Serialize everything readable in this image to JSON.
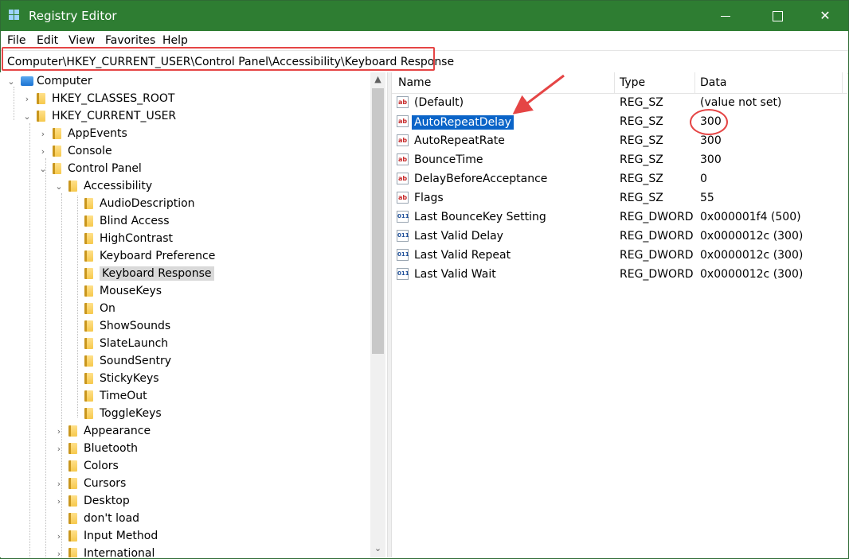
{
  "window": {
    "title": "Registry Editor"
  },
  "menu": [
    "File",
    "Edit",
    "View",
    "Favorites",
    "Help"
  ],
  "address": "Computer\\HKEY_CURRENT_USER\\Control Panel\\Accessibility\\Keyboard Response",
  "tree": [
    "Computer",
    "HKEY_CLASSES_ROOT",
    "HKEY_CURRENT_USER",
    "AppEvents",
    "Console",
    "Control Panel",
    "Accessibility",
    "AudioDescription",
    "Blind Access",
    "HighContrast",
    "Keyboard Preference",
    "Keyboard Response",
    "MouseKeys",
    "On",
    "ShowSounds",
    "SlateLaunch",
    "SoundSentry",
    "StickyKeys",
    "TimeOut",
    "ToggleKeys",
    "Appearance",
    "Bluetooth",
    "Colors",
    "Cursors",
    "Desktop",
    "don't load",
    "Input Method",
    "International"
  ],
  "columns": {
    "name": "Name",
    "type": "Type",
    "data": "Data"
  },
  "values": [
    {
      "icon": "string-value-icon",
      "name": "(Default)",
      "type": "REG_SZ",
      "data": "(value not set)"
    },
    {
      "icon": "string-value-icon",
      "name": "AutoRepeatDelay",
      "type": "REG_SZ",
      "data": "300"
    },
    {
      "icon": "string-value-icon",
      "name": "AutoRepeatRate",
      "type": "REG_SZ",
      "data": "300"
    },
    {
      "icon": "string-value-icon",
      "name": "BounceTime",
      "type": "REG_SZ",
      "data": "300"
    },
    {
      "icon": "string-value-icon",
      "name": "DelayBeforeAcceptance",
      "type": "REG_SZ",
      "data": "0"
    },
    {
      "icon": "string-value-icon",
      "name": "Flags",
      "type": "REG_SZ",
      "data": "55"
    },
    {
      "icon": "dword-value-icon",
      "name": "Last BounceKey Setting",
      "type": "REG_DWORD",
      "data": "0x000001f4 (500)"
    },
    {
      "icon": "dword-value-icon",
      "name": "Last Valid Delay",
      "type": "REG_DWORD",
      "data": "0x0000012c (300)"
    },
    {
      "icon": "dword-value-icon",
      "name": "Last Valid Repeat",
      "type": "REG_DWORD",
      "data": "0x0000012c (300)"
    },
    {
      "icon": "dword-value-icon",
      "name": "Last Valid Wait",
      "type": "REG_DWORD",
      "data": "0x0000012c (300)"
    }
  ],
  "colors": {
    "titlebar": "#2e7d32",
    "selection": "#0a64c8",
    "annotation": "#e54545"
  }
}
